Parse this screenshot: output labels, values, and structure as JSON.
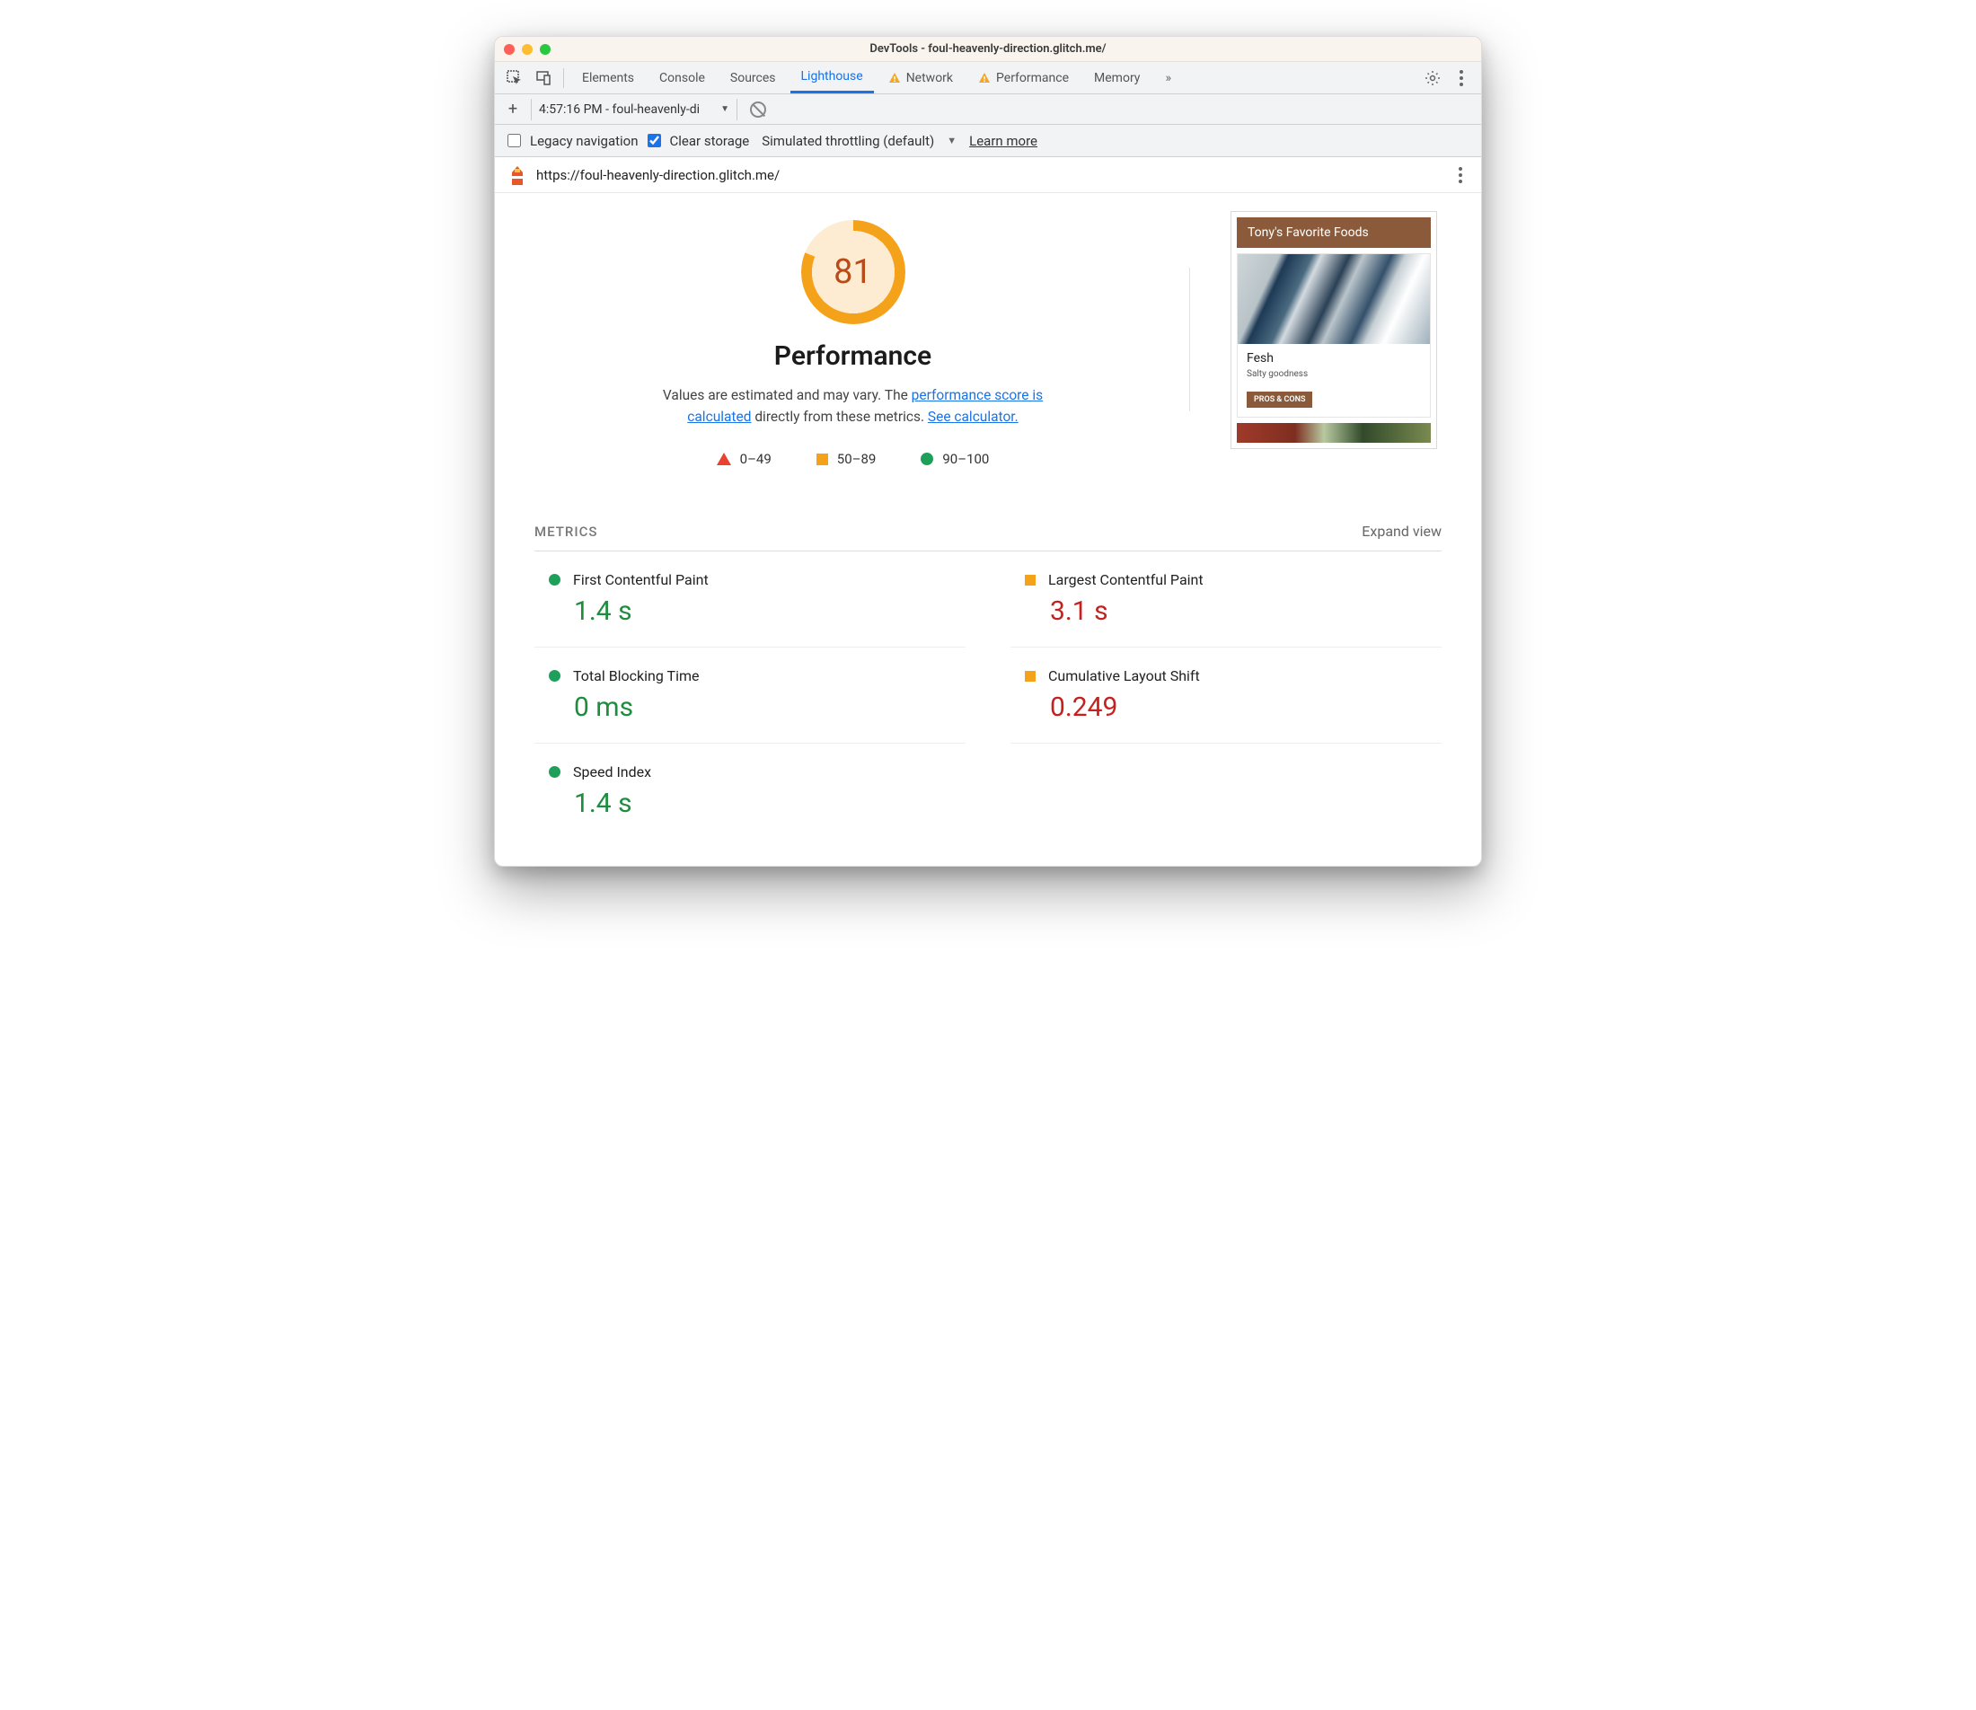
{
  "window": {
    "title": "DevTools - foul-heavenly-direction.glitch.me/"
  },
  "tabs": {
    "elements": "Elements",
    "console": "Console",
    "sources": "Sources",
    "lighthouse": "Lighthouse",
    "network": "Network",
    "performance": "Performance",
    "memory": "Memory"
  },
  "subbar": {
    "dropdown": "4:57:16 PM - foul-heavenly-di"
  },
  "options": {
    "legacy": "Legacy navigation",
    "clear": "Clear storage",
    "throttle": "Simulated throttling (default)",
    "learn": "Learn more"
  },
  "url": "https://foul-heavenly-direction.glitch.me/",
  "gauge": {
    "score": "81"
  },
  "section": {
    "title": "Performance",
    "desc1": "Values are estimated and may vary. The ",
    "link1": "performance score is calculated",
    "desc2": " directly from these metrics. ",
    "link2": "See calculator."
  },
  "legend": {
    "a": "0–49",
    "b": "50–89",
    "c": "90–100"
  },
  "preview": {
    "header": "Tony's Favorite Foods",
    "card_title": "Fesh",
    "card_sub": "Salty goodness",
    "card_btn": "PROS & CONS"
  },
  "metrics": {
    "heading": "METRICS",
    "expand": "Expand view",
    "items": [
      {
        "label": "First Contentful Paint",
        "value": "1.4 s",
        "status": "good"
      },
      {
        "label": "Largest Contentful Paint",
        "value": "3.1 s",
        "status": "avg"
      },
      {
        "label": "Total Blocking Time",
        "value": "0 ms",
        "status": "good"
      },
      {
        "label": "Cumulative Layout Shift",
        "value": "0.249",
        "status": "avg"
      },
      {
        "label": "Speed Index",
        "value": "1.4 s",
        "status": "good"
      }
    ]
  }
}
